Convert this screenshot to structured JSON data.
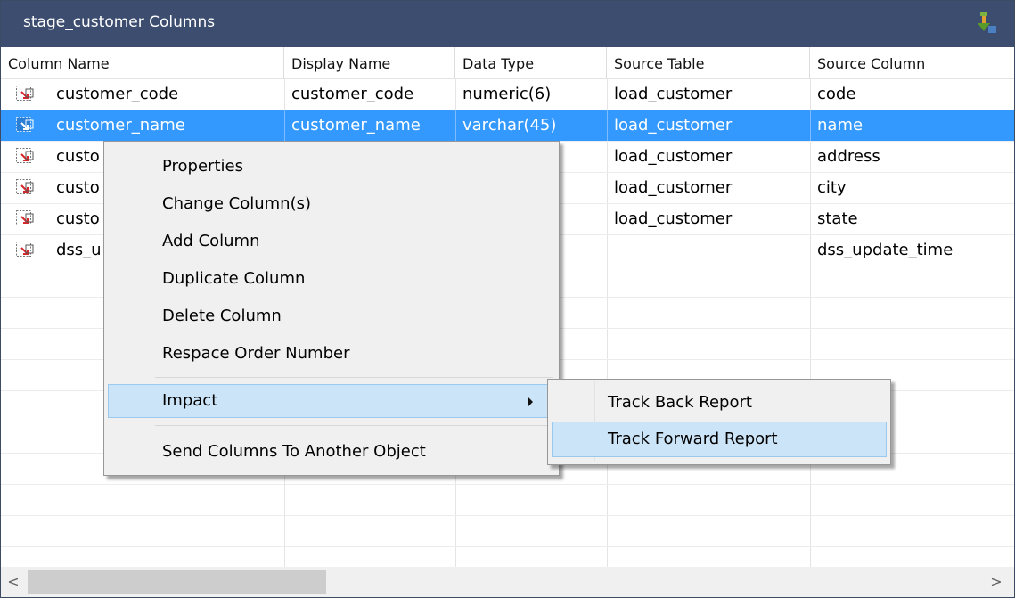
{
  "panel": {
    "title": "stage_customer Columns",
    "pin_icon": "pin-icon"
  },
  "table": {
    "columns": [
      "Column Name",
      "Display Name",
      "Data Type",
      "Source Table",
      "Source Column"
    ],
    "rows": [
      [
        "customer_code",
        "customer_code",
        "numeric(6)",
        "load_customer",
        "code"
      ],
      [
        "customer_name",
        "customer_name",
        "varchar(45)",
        "load_customer",
        "name"
      ],
      [
        "custo",
        "",
        ")",
        "load_customer",
        "address"
      ],
      [
        "custo",
        "",
        ")",
        "load_customer",
        "city"
      ],
      [
        "custo",
        "",
        "",
        "load_customer",
        "state"
      ],
      [
        "dss_u",
        "",
        "",
        "",
        "dss_update_time"
      ]
    ],
    "selected_row": 1
  },
  "context_menu": {
    "items": [
      "Properties",
      "Change Column(s)",
      "Add Column",
      "Duplicate Column",
      "Delete Column",
      "Respace Order Number",
      "Impact",
      "Send Columns To Another Object"
    ]
  },
  "impact_submenu": {
    "items": [
      "Track Back Report",
      "Track Forward Report"
    ]
  },
  "scrollbar": {
    "left_arrow": "<",
    "right_arrow": ">"
  },
  "colors": {
    "titlebar": "#3c4d6f",
    "selection": "#3399ff",
    "menu_highlight": "#cce4f7"
  }
}
